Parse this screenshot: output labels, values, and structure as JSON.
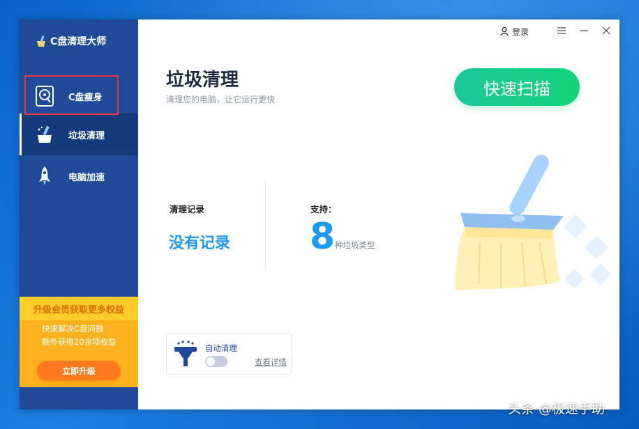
{
  "app": {
    "title": "C盘清理大师"
  },
  "sidebar": {
    "items": [
      {
        "label": "C盘瘦身",
        "icon": "disk-icon"
      },
      {
        "label": "垃圾清理",
        "icon": "broom-icon"
      },
      {
        "label": "电脑加速",
        "icon": "rocket-icon"
      }
    ],
    "active_index": 1
  },
  "promo": {
    "title": "升级会员获取更多权益",
    "lines": [
      "快速解决C盘问题",
      "额外获得20余项权益"
    ],
    "button": "立即升级"
  },
  "topbar": {
    "login": "登录"
  },
  "main": {
    "title": "垃圾清理",
    "subtitle": "清理您的电脑，让它运行更快",
    "scan_button": "快速扫描",
    "record_label": "清理记录",
    "record_value": "没有记录",
    "support_label": "支持：",
    "support_count": "8",
    "support_unit": "种垃圾类型"
  },
  "auto_clean": {
    "label": "自动清理",
    "details": "查看详情",
    "enabled": false
  },
  "watermark": "头条 @极速手助",
  "colors": {
    "sidebar": "#1f4a97",
    "sidebar_active": "#153a7c",
    "accent_blue": "#1d9bf0",
    "scan_green": "#12d37a",
    "promo_orange": "#ffb21d",
    "upgrade_button": "#ff7a1f",
    "highlight_red": "#e53b3b"
  }
}
